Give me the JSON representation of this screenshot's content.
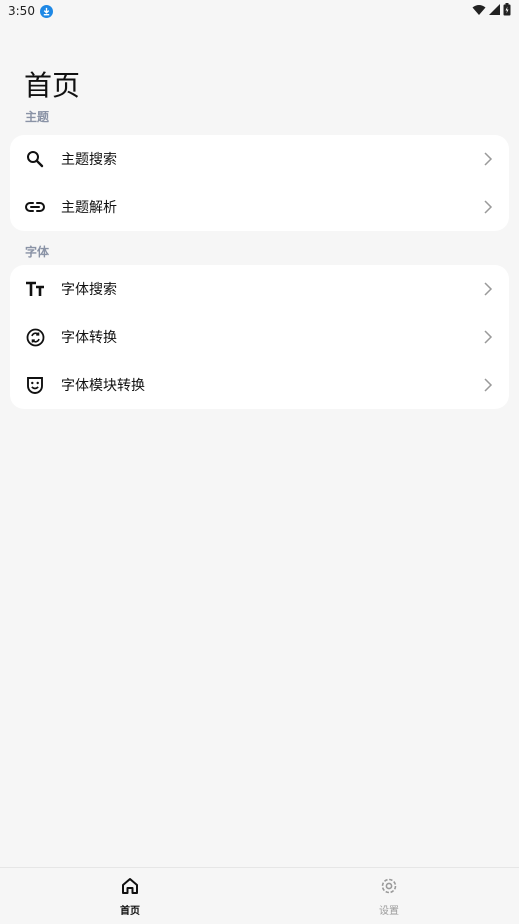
{
  "status_bar": {
    "time": "3:50",
    "icons": [
      "download-icon",
      "wifi-icon",
      "signal-icon",
      "battery-icon"
    ]
  },
  "page": {
    "title": "首页"
  },
  "sections": [
    {
      "label": "主题",
      "items": [
        {
          "label": "主题搜索",
          "icon": "search-icon"
        },
        {
          "label": "主题解析",
          "icon": "link-icon"
        }
      ]
    },
    {
      "label": "字体",
      "items": [
        {
          "label": "字体搜索",
          "icon": "text-size-icon"
        },
        {
          "label": "字体转换",
          "icon": "convert-icon"
        },
        {
          "label": "字体模块转换",
          "icon": "theater-mask-icon"
        }
      ]
    }
  ],
  "bottom_nav": {
    "items": [
      {
        "label": "首页",
        "icon": "home-icon",
        "active": true
      },
      {
        "label": "设置",
        "icon": "settings-gear-icon",
        "active": false
      }
    ]
  },
  "colors": {
    "background": "#f6f6f6",
    "card": "#ffffff",
    "section_label": "#8a93a6",
    "accent_download": "#1e88e5",
    "inactive_nav": "#9a9a9a"
  }
}
